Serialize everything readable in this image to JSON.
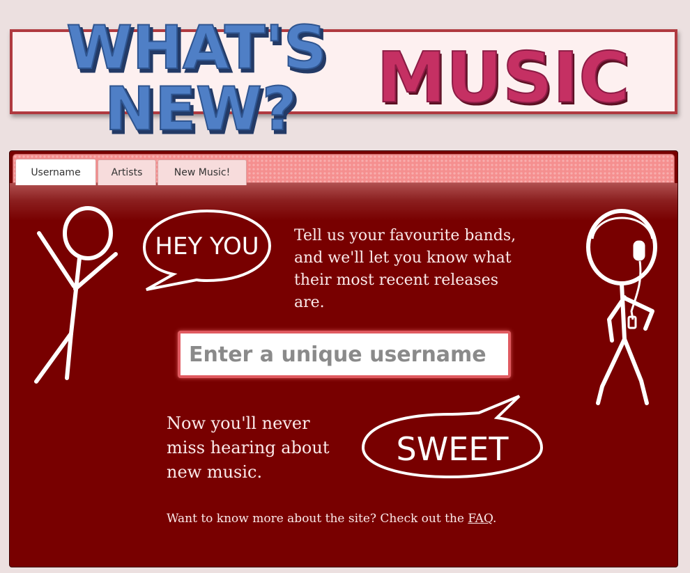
{
  "logo": {
    "line1": "WHAT'S",
    "line2": "NEW?",
    "music": "MUSIC",
    "blue": "#4f7fc6",
    "pink": "#c53063"
  },
  "tabs": [
    {
      "label": "Username",
      "active": true
    },
    {
      "label": "Artists",
      "active": false
    },
    {
      "label": "New Music!",
      "active": false
    }
  ],
  "bubbles": {
    "hey": "HEY YOU",
    "sweet": "SWEET"
  },
  "intro_text": "Tell us your favourite bands, and we'll let you know what their most recent releases are.",
  "username_input": {
    "placeholder": "Enter a unique username",
    "value": ""
  },
  "outro_text": "Now you'll never miss hearing about new music.",
  "faq": {
    "prefix": "Want to know more about the site? Check out the ",
    "link": "FAQ",
    "suffix": "."
  },
  "colors": {
    "panel": "#780000",
    "tabbar": "#f58f8f",
    "banner_border": "#b03a40",
    "page_bg": "#ece0e0"
  }
}
